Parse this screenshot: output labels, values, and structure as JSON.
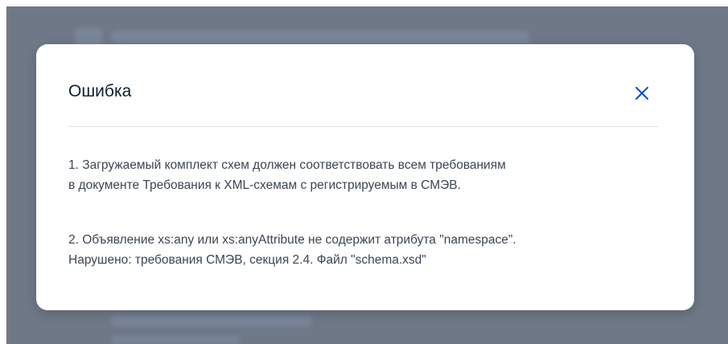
{
  "modal": {
    "title": "Ошибка",
    "close_icon": "close-icon",
    "messages": [
      {
        "line1": "1. Загружаемый комплект схем должен соответствовать всем требованиям",
        "line2": "в документе Требования к XML-схемам с регистрируемым в СМЭВ."
      },
      {
        "line1": "2. Объявление xs:any или xs:anyAttribute не содержит атрибута \"namespace\".",
        "line2": "Нарушено: требования СМЭВ, секция 2.4. Файл \"schema.xsd\""
      }
    ]
  },
  "colors": {
    "overlay": "#6e7887",
    "modal_background": "#ffffff",
    "title_text": "#0b1f33",
    "body_text": "#3a4654",
    "close_icon": "#0d4cd3",
    "divider": "#dfe3e8"
  }
}
